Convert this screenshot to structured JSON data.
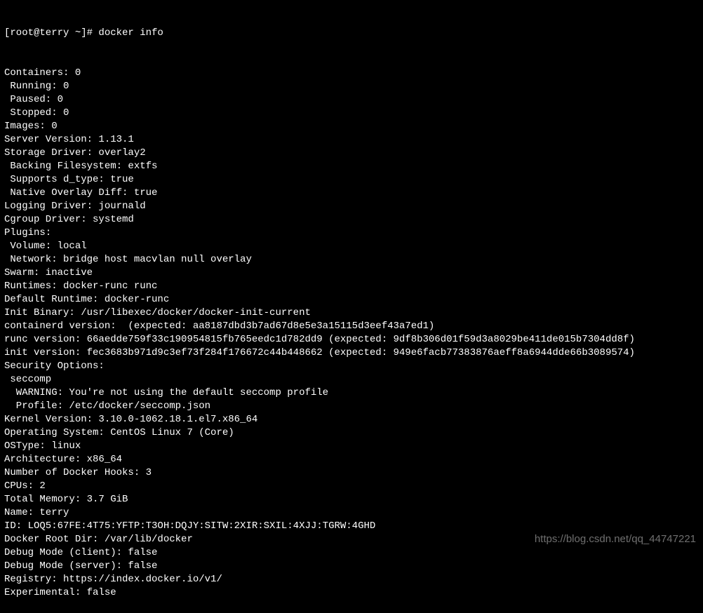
{
  "prompt_line": "[root@terry ~]# docker info",
  "lines": [
    "Containers: 0",
    " Running: 0",
    " Paused: 0",
    " Stopped: 0",
    "Images: 0",
    "Server Version: 1.13.1",
    "Storage Driver: overlay2",
    " Backing Filesystem: extfs",
    " Supports d_type: true",
    " Native Overlay Diff: true",
    "Logging Driver: journald",
    "Cgroup Driver: systemd",
    "Plugins:",
    " Volume: local",
    " Network: bridge host macvlan null overlay",
    "Swarm: inactive",
    "Runtimes: docker-runc runc",
    "Default Runtime: docker-runc",
    "Init Binary: /usr/libexec/docker/docker-init-current",
    "containerd version:  (expected: aa8187dbd3b7ad67d8e5e3a15115d3eef43a7ed1)",
    "runc version: 66aedde759f33c190954815fb765eedc1d782dd9 (expected: 9df8b306d01f59d3a8029be411de015b7304dd8f)",
    "init version: fec3683b971d9c3ef73f284f176672c44b448662 (expected: 949e6facb77383876aeff8a6944dde66b3089574)",
    "Security Options:",
    " seccomp",
    "  WARNING: You're not using the default seccomp profile",
    "  Profile: /etc/docker/seccomp.json",
    "Kernel Version: 3.10.0-1062.18.1.el7.x86_64",
    "Operating System: CentOS Linux 7 (Core)",
    "OSType: linux",
    "Architecture: x86_64",
    "Number of Docker Hooks: 3",
    "CPUs: 2",
    "Total Memory: 3.7 GiB",
    "Name: terry",
    "ID: LOQ5:67FE:4T75:YFTP:T3OH:DQJY:SITW:2XIR:SXIL:4XJJ:TGRW:4GHD",
    "Docker Root Dir: /var/lib/docker",
    "Debug Mode (client): false",
    "Debug Mode (server): false",
    "Registry: https://index.docker.io/v1/",
    "Experimental: false"
  ],
  "watermark": "https://blog.csdn.net/qq_44747221"
}
